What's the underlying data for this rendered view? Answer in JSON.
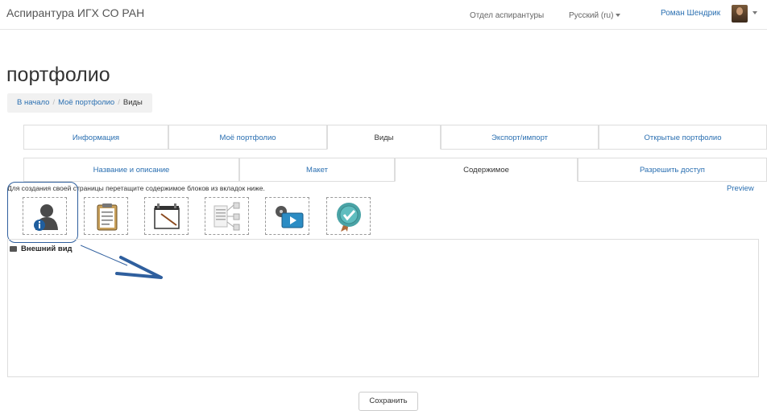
{
  "navbar": {
    "brand": "Аспирантура ИГХ СО РАН",
    "dept_link": "Отдел аспирантуры",
    "language": "Русский (ru)",
    "user_name": "Роман Шендрик"
  },
  "page": {
    "title": "портфолио"
  },
  "breadcrumb": {
    "home": "В начало",
    "portfolio": "Моё портфолио",
    "current": "Виды"
  },
  "main_tabs": [
    "Информация",
    "Моё портфолио",
    "Виды",
    "Экспорт/импорт",
    "Открытые портфолио"
  ],
  "sub_tabs": [
    "Название и описание",
    "Макет",
    "Содержимое",
    "Разрешить доступ"
  ],
  "editor": {
    "hint": "Для создания своей страницы перетащите содержимое блоков из вкладок ниже.",
    "preview": "Preview",
    "block_icons": [
      "profile-info-icon",
      "clipboard-icon",
      "notebook-icon",
      "file-tree-icon",
      "video-icon",
      "badge-icon"
    ],
    "section_title": "Внешний вид"
  },
  "actions": {
    "save": "Сохранить"
  },
  "colors": {
    "link": "#2a6fb1",
    "highlight": "#2f5f9e"
  }
}
